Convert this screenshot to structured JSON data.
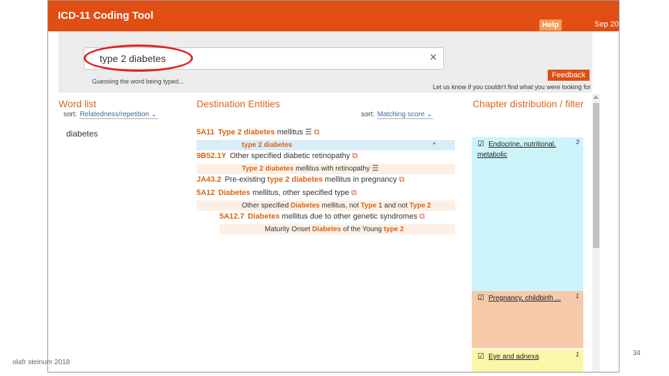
{
  "app": {
    "title": "ICD-11 Coding Tool",
    "help_label": "Help",
    "date_text": "Sep 20"
  },
  "search": {
    "value": "type 2 diabetes",
    "clear_symbol": "×",
    "guess_text": "Guessing the word being typed...",
    "feedback_label": "Feedback",
    "feedback_hint": "Let us know if you couldn't find what you were looking for"
  },
  "word_list": {
    "heading": "Word list",
    "sort_label": "sort:",
    "sort_value": "Relatedness/repetition",
    "items": [
      "diabetes"
    ]
  },
  "destination": {
    "heading": "Destination Entities",
    "sort_label": "sort:",
    "sort_value": "Matching score",
    "rows": [
      {
        "code": "5A11",
        "parts": [
          "Type 2 diabetes",
          " mellitus"
        ]
      },
      {
        "sub_parts": [
          "type 2 diabetes"
        ],
        "star": "*"
      },
      {
        "code": "9B52.1Y",
        "parts": [
          "",
          "Other specified diabetic retinopathy"
        ]
      },
      {
        "sub_parts": [
          "Type 2 diabetes",
          " mellitus with retinopathy"
        ]
      },
      {
        "code": "JA43.2",
        "parts": [
          "Pre-existing ",
          "type 2 diabetes",
          " mellitus in pregnancy"
        ]
      },
      {
        "code": "5A12",
        "parts": [
          "Diabetes",
          " mellitus, other specified type"
        ]
      },
      {
        "sub_parts": [
          "Other specified ",
          "Diabetes",
          " mellitus, not ",
          "Type",
          " 1 and not ",
          "Type 2"
        ]
      },
      {
        "code": "5A12.7",
        "parts": [
          "Diabetes",
          " mellitus due to other genetic syndromes"
        ]
      },
      {
        "sub_parts": [
          "Maturity Onset ",
          "Diabetes",
          " of the Young ",
          "type 2"
        ]
      }
    ]
  },
  "chapters": {
    "heading": "Chapter distribution / filter",
    "items": [
      {
        "label": "Endocrine, nutritional, metabolic",
        "count": "3",
        "color": "#ccf5fb"
      },
      {
        "label": "Pregnancy, childbirth ...",
        "count": "1",
        "color": "#f7c9ab"
      },
      {
        "label": "Eye and adnexa",
        "count": "1",
        "color": "#fbf6a8"
      }
    ]
  },
  "icons": {
    "external_link": "external-link-icon",
    "list": "list-icon",
    "check": "checkbox-icon",
    "ext_glyph": "⧉",
    "list_glyph": "☰",
    "check_glyph": "☑"
  },
  "slide": {
    "author": "olafr steinum 2018",
    "page": "34"
  },
  "colors": {
    "brand": "#e04e14",
    "accent_text": "#d96412"
  }
}
